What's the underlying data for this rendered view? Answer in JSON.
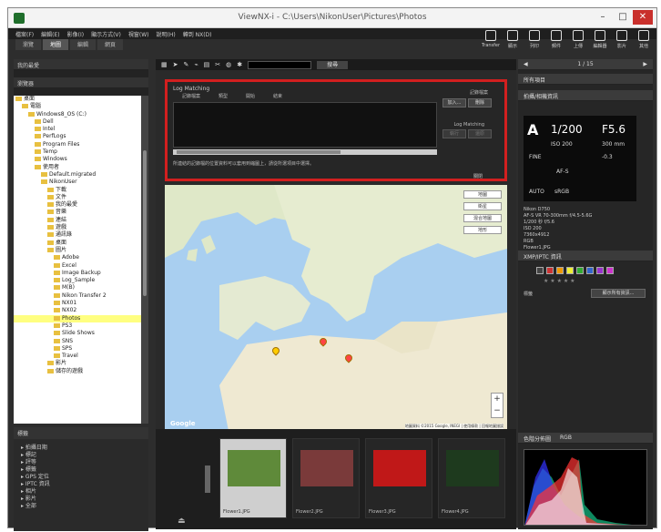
{
  "window": {
    "title": "ViewNX-i - C:\\Users\\NikonUser\\Pictures\\Photos"
  },
  "menu": [
    "檔案(F)",
    "編輯(E)",
    "影像(I)",
    "顯示方式(V)",
    "視窗(W)",
    "說明(H)",
    "轉到 NX(D)"
  ],
  "modes": [
    "瀏覽",
    "地圖",
    "編輯",
    "網頁"
  ],
  "toolbar_buttons": [
    {
      "label": "Transfer",
      "icon": "transfer-icon"
    },
    {
      "label": "顯示",
      "icon": "display-icon"
    },
    {
      "label": "列印",
      "icon": "print-icon"
    },
    {
      "label": "郵件",
      "icon": "mail-icon"
    },
    {
      "label": "上傳",
      "icon": "upload-icon"
    },
    {
      "label": "編輯器",
      "icon": "editor-icon"
    },
    {
      "label": "影片",
      "icon": "movie-icon"
    },
    {
      "label": "其他",
      "icon": "more-icon"
    }
  ],
  "left": {
    "fav_header": "我的最愛",
    "browser_header": "瀏覽器",
    "tree": [
      {
        "label": "桌面",
        "indent": 0
      },
      {
        "label": "電腦",
        "indent": 1
      },
      {
        "label": "Windows8_OS (C:)",
        "indent": 2
      },
      {
        "label": "Dell",
        "indent": 3
      },
      {
        "label": "Intel",
        "indent": 3
      },
      {
        "label": "PerfLogs",
        "indent": 3
      },
      {
        "label": "Program Files",
        "indent": 3
      },
      {
        "label": "Temp",
        "indent": 3
      },
      {
        "label": "Windows",
        "indent": 3
      },
      {
        "label": "使用者",
        "indent": 3
      },
      {
        "label": "Default.migrated",
        "indent": 4
      },
      {
        "label": "NikonUser",
        "indent": 4
      },
      {
        "label": "下載",
        "indent": 5
      },
      {
        "label": "文件",
        "indent": 5
      },
      {
        "label": "我的最愛",
        "indent": 5
      },
      {
        "label": "音樂",
        "indent": 5
      },
      {
        "label": "連結",
        "indent": 5
      },
      {
        "label": "遊戲",
        "indent": 5
      },
      {
        "label": "通訊錄",
        "indent": 5
      },
      {
        "label": "桌面",
        "indent": 5
      },
      {
        "label": "圖片",
        "indent": 5
      },
      {
        "label": "Adobe",
        "indent": 6
      },
      {
        "label": "Excel",
        "indent": 6
      },
      {
        "label": "Image Backup",
        "indent": 6
      },
      {
        "label": "Log_Sample",
        "indent": 6
      },
      {
        "label": "M(B)",
        "indent": 6
      },
      {
        "label": "Nikon Transfer 2",
        "indent": 6
      },
      {
        "label": "NX01",
        "indent": 6
      },
      {
        "label": "NX02",
        "indent": 6
      },
      {
        "label": "Photos",
        "indent": 6,
        "selected": true
      },
      {
        "label": "PS3",
        "indent": 6
      },
      {
        "label": "Slide Shows",
        "indent": 6
      },
      {
        "label": "SNS",
        "indent": 6
      },
      {
        "label": "SPS",
        "indent": 6
      },
      {
        "label": "Travel",
        "indent": 6
      },
      {
        "label": "影片",
        "indent": 5
      },
      {
        "label": "儲存的遊戲",
        "indent": 5
      }
    ],
    "bottom_header": "標籤",
    "bottom_items": [
      "拍攝日期",
      "標記",
      "評等",
      "標籤",
      "GPS 定位",
      "IPTC 資訊",
      "相片",
      "影片",
      "全部"
    ]
  },
  "center": {
    "search_label": "搜尋",
    "log": {
      "title": "Log Matching",
      "columns": [
        "記錄檔案",
        "類型",
        "開始",
        "結束"
      ],
      "note": "所連結的記錄檔的位置資料可以套用到縮圖上，請從所選項目中選擇。",
      "log_file_label": "記錄檔案",
      "add_button": "加入...",
      "remove_button": "刪除",
      "matching_label": "Log Matching",
      "match_button": "執行",
      "undo_button": "還原",
      "close_button": "關閉"
    },
    "map": {
      "buttons": [
        "地圖",
        "衛星",
        "混合地圖",
        "地形"
      ],
      "logo": "Google",
      "copyright": "地圖資料 ©2015 Google, INEGI | 使用條款 | 回報地圖錯誤"
    }
  },
  "filmstrip": {
    "thumbs": [
      {
        "name": "Flower1.JPG",
        "selected": true,
        "color": "#5f8a3a"
      },
      {
        "name": "Flower2.JPG",
        "selected": false,
        "color": "#7a3a3a"
      },
      {
        "name": "Flower3.JPG",
        "selected": false,
        "color": "#c01818"
      },
      {
        "name": "Flower4.JPG",
        "selected": false,
        "color": "#1e3a1e"
      }
    ]
  },
  "right": {
    "nav": "1 / 15",
    "tab_label": "所有項目",
    "info_header": "拍攝/相機資訊",
    "exif": {
      "mode": "A",
      "shutter": "1/200",
      "aperture": "F5.6",
      "iso": "ISO 200",
      "focal": "300 mm",
      "quality": "FINE",
      "ev": "-0.3",
      "af": "AF-S",
      "color": "sRGB",
      "wb": "AUTO"
    },
    "meta_lines": [
      "Nikon D750",
      "AF-S VR 70-300mm f/4.5-5.6G",
      "1/200 秒 f/5.6",
      "ISO 200",
      "7360x4912",
      "RGB",
      "Flower1.JPG"
    ],
    "xmp_header": "XMP/IPTC 資訊",
    "rating_label": "標籤",
    "xmp_button": "顯示所有資訊...",
    "histogram_header": "色階分佈圖",
    "histogram_channel": "RGB"
  }
}
